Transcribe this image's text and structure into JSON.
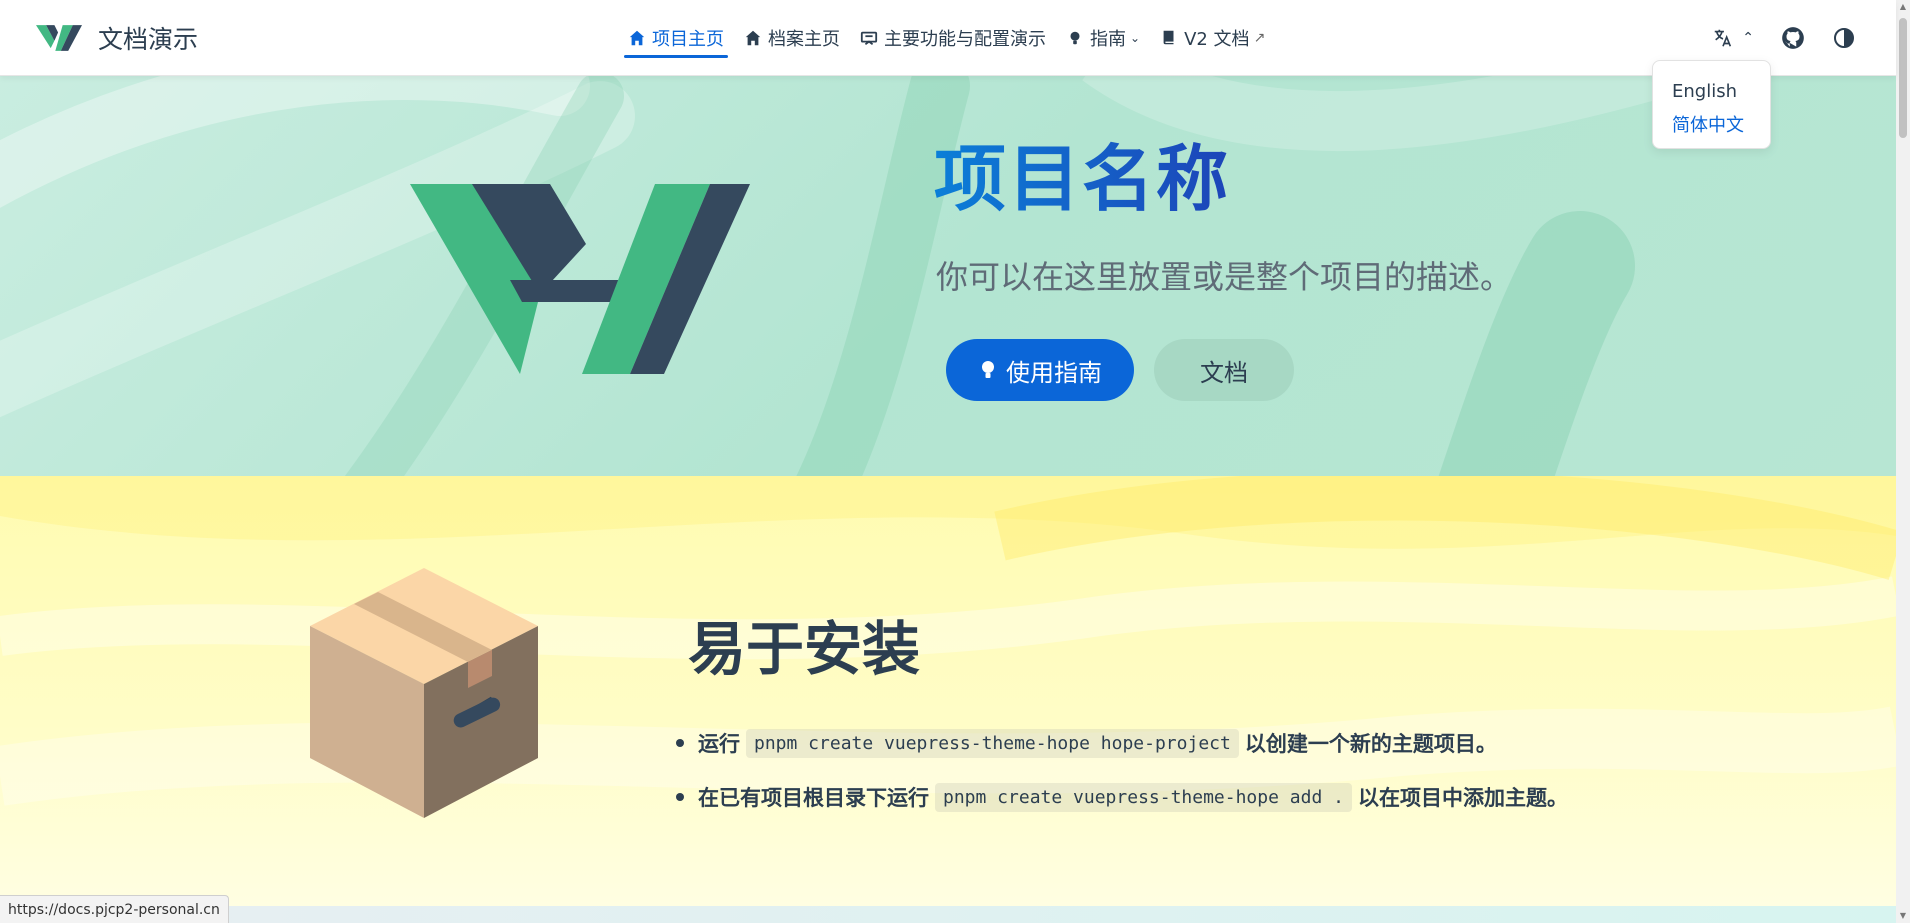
{
  "brand": {
    "title": "文档演示",
    "logo_colors": [
      "#42b883",
      "#35495e"
    ]
  },
  "nav": {
    "items": [
      {
        "label": "项目主页",
        "icon": "home-icon",
        "active": true
      },
      {
        "label": "档案主页",
        "icon": "home-icon",
        "active": false
      },
      {
        "label": "主要功能与配置演示",
        "icon": "slides-icon",
        "active": false
      },
      {
        "label": "指南",
        "icon": "lightbulb-icon",
        "active": false,
        "dropdown": true
      },
      {
        "label": "V2 文档",
        "icon": "book-icon",
        "active": false,
        "external": true
      }
    ],
    "right": {
      "language_icon": "translate-icon",
      "github_icon": "github-icon",
      "theme_icon": "contrast-icon"
    }
  },
  "language_menu": {
    "options": [
      "English",
      "简体中文"
    ],
    "current": "简体中文"
  },
  "hero": {
    "title": "项目名称",
    "description": "你可以在这里放置或是整个项目的描述。",
    "primary_button": "使用指南",
    "secondary_button": "文档"
  },
  "feature": {
    "title": "易于安装",
    "items": [
      {
        "before": "运行",
        "code": "pnpm create vuepress-theme-hope hope-project",
        "after": "以创建一个新的主题项目。"
      },
      {
        "before": "在已有项目根目录下运行",
        "code": "pnpm create vuepress-theme-hope add .",
        "after": "以在项目中添加主题。"
      }
    ]
  },
  "status_bar": {
    "url": "https://docs.pjcp2-personal.cn"
  },
  "colors": {
    "accent": "#0b66d8",
    "text": "#2c3e50",
    "hero_bg": "#b3e5d2",
    "feature_bg": "#fffbb0"
  }
}
